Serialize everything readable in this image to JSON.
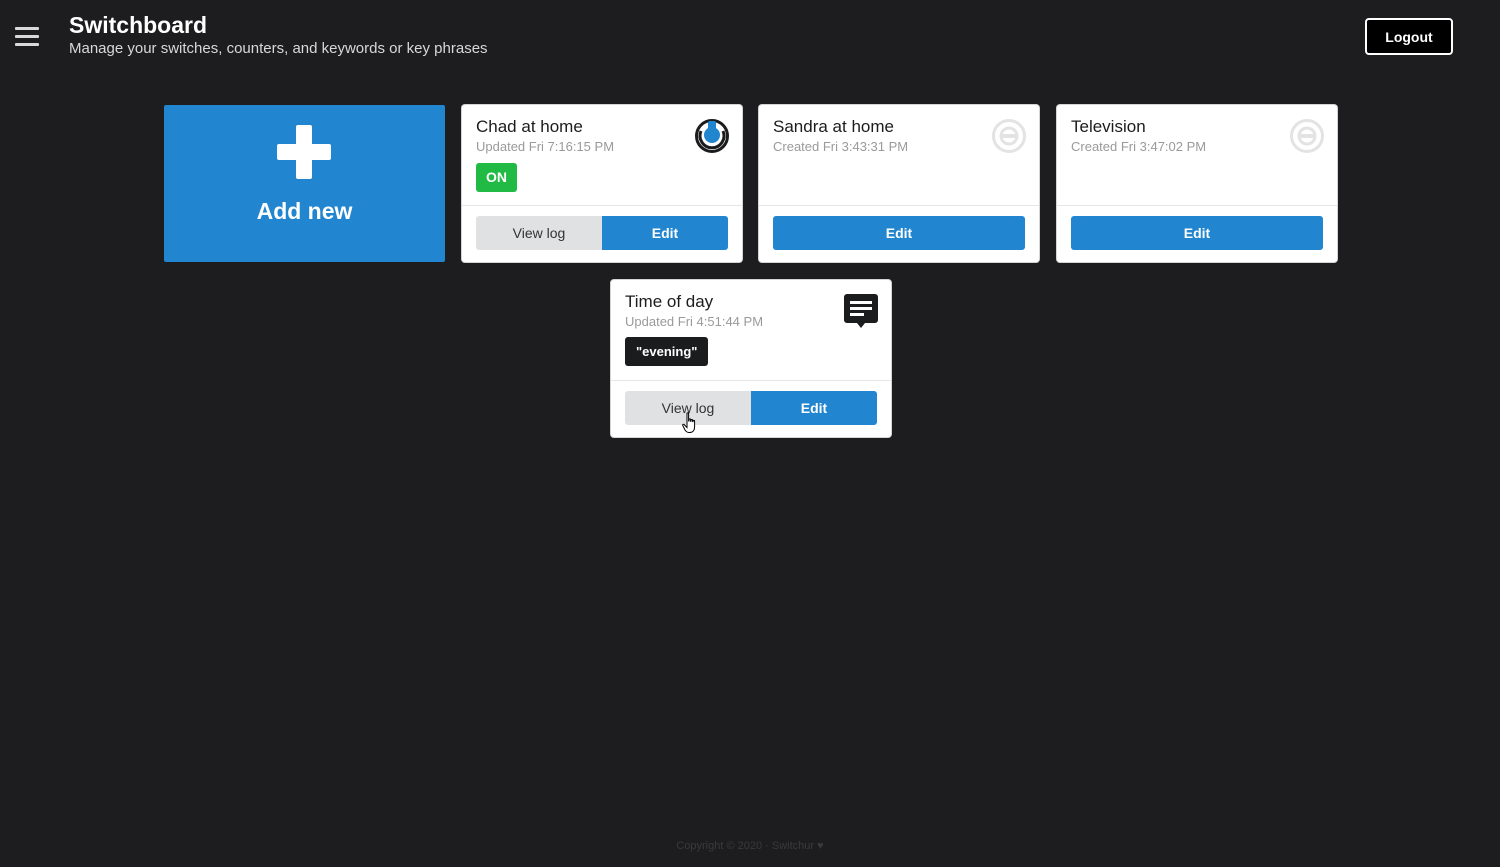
{
  "header": {
    "title": "Switchboard",
    "subtitle": "Manage your switches, counters, and keywords or key phrases",
    "logout_label": "Logout",
    "menu_icon": "hamburger-menu-icon"
  },
  "add_tile": {
    "label": "Add new",
    "icon": "plus-icon"
  },
  "cards": [
    {
      "title": "Chad at home",
      "meta": "Updated Fri 7:16:15 PM",
      "status": "ON",
      "icon": "switch-on-icon",
      "view_log_label": "View log",
      "edit_label": "Edit"
    },
    {
      "title": "Sandra at home",
      "meta": "Created Fri 3:43:31 PM",
      "icon": "switch-off-icon",
      "edit_label": "Edit"
    },
    {
      "title": "Television",
      "meta": "Created Fri 3:47:02 PM",
      "icon": "switch-off-icon",
      "edit_label": "Edit"
    },
    {
      "title": "Time of day",
      "meta": "Updated Fri 4:51:44 PM",
      "keyword": "\"evening\"",
      "icon": "keyword-message-icon",
      "view_log_label": "View log",
      "edit_label": "Edit"
    }
  ],
  "footer": {
    "text": "Copyright © 2020 · Switchur ♥"
  },
  "colors": {
    "background": "#1d1d1f",
    "primary": "#2185d0",
    "on_status": "#21ba45",
    "switch_on_accent": "#2185d0"
  }
}
